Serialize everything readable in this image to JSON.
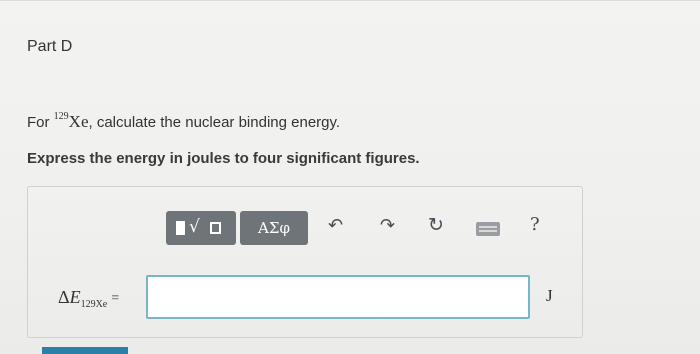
{
  "part": {
    "title": "Part D"
  },
  "question": {
    "prefix": "For ",
    "mass_number": "129",
    "element": "Xe",
    "suffix": ", calculate the nuclear binding energy.",
    "instruction": "Express the energy in joules to four significant figures."
  },
  "toolbar": {
    "greek_label": "ΑΣφ",
    "icons": [
      "templates-icon",
      "undo-icon",
      "redo-icon",
      "reset-icon",
      "keyboard-icon",
      "help-icon"
    ],
    "help_label": "?"
  },
  "answer": {
    "delta_symbol": "Δ",
    "variable": "E",
    "subscript": "129Xe",
    "equals": "=",
    "value": "",
    "unit": "J"
  },
  "colors": {
    "input_border": "#79b6c4",
    "button_bg": "#6f7478",
    "submit": "#2c7fa8"
  }
}
